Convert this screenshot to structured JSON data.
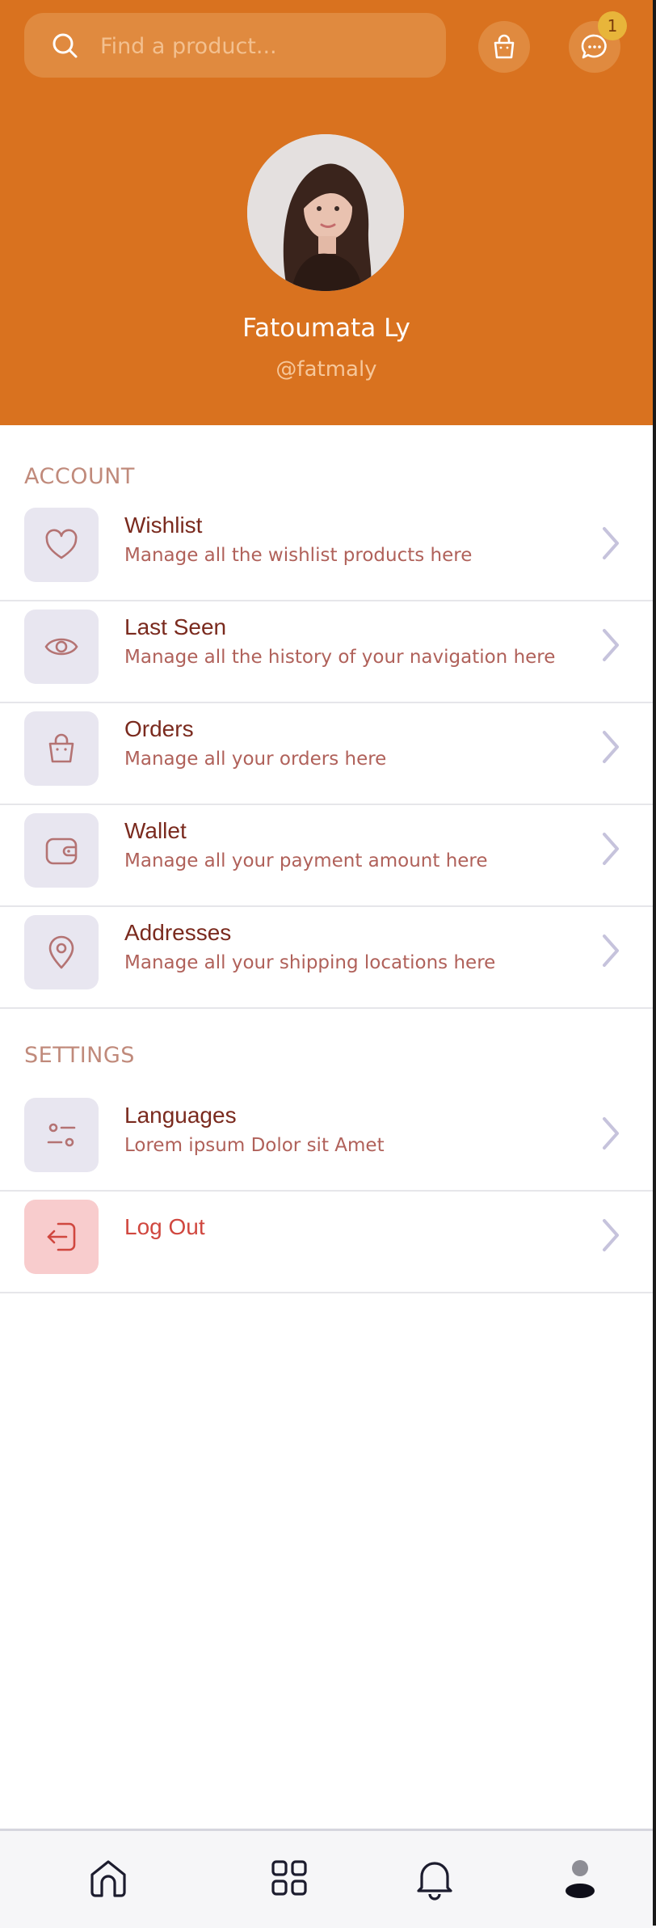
{
  "search": {
    "placeholder": "Find a product..."
  },
  "header": {
    "cart_icon": "shopping-bag-icon",
    "chat_icon": "chat-icon",
    "chat_badge": "1",
    "accent_color": "#d9721f"
  },
  "profile": {
    "name": "Fatoumata Ly",
    "handle": "@fatmaly"
  },
  "account": {
    "title": "ACCOUNT",
    "items": [
      {
        "label": "Wishlist",
        "sub": "Manage all the wishlist products here",
        "icon": "heart-icon"
      },
      {
        "label": "Last Seen",
        "sub": "Manage all the history of your navigation here",
        "icon": "eye-icon"
      },
      {
        "label": "Orders",
        "sub": "Manage all your orders here",
        "icon": "bag-icon"
      },
      {
        "label": "Wallet",
        "sub": "Manage all your payment amount here",
        "icon": "wallet-icon"
      },
      {
        "label": "Addresses",
        "sub": "Manage all your shipping locations here",
        "icon": "location-pin-icon"
      }
    ]
  },
  "settings": {
    "title": "SETTINGS",
    "items": [
      {
        "label": "Languages",
        "sub": "Lorem ipsum Dolor sit Amet",
        "icon": "sliders-icon"
      },
      {
        "label": "Log Out",
        "icon": "logout-icon"
      }
    ]
  },
  "nav": {
    "items": [
      {
        "icon": "home-icon"
      },
      {
        "icon": "grid-icon"
      },
      {
        "icon": "bell-icon"
      },
      {
        "icon": "profile-icon",
        "active": true
      }
    ]
  }
}
